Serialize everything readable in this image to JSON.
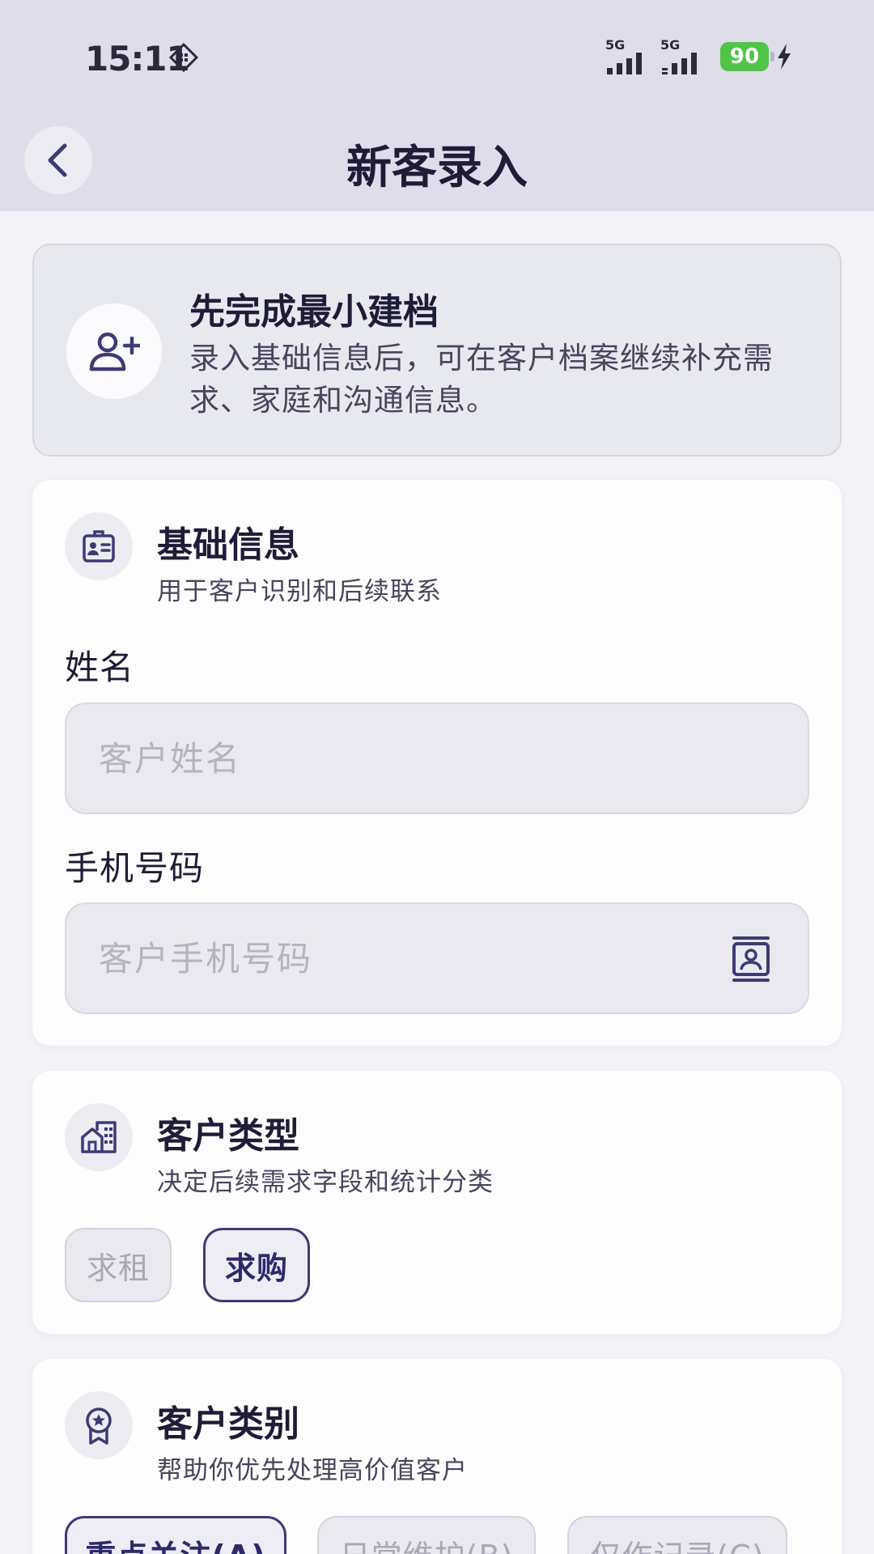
{
  "status_bar": {
    "time": "15:11",
    "sim1_label": "5G",
    "sim2_label": "5G",
    "battery": "90"
  },
  "header": {
    "title": "新客录入",
    "back_icon": "chevron-left-icon"
  },
  "intro": {
    "title": "先完成最小建档",
    "description": "录入基础信息后，可在客户档案继续补充需求、家庭和沟通信息。",
    "icon": "add-user-icon"
  },
  "basic_info": {
    "title": "基础信息",
    "subtitle": "用于客户识别和后续联系",
    "name_label": "姓名",
    "name_placeholder": "客户姓名",
    "name_value": "",
    "phone_label": "手机号码",
    "phone_placeholder": "客户手机号码",
    "phone_value": ""
  },
  "customer_type": {
    "title": "客户类型",
    "subtitle": "决定后续需求字段和统计分类",
    "options": [
      {
        "label": "求租",
        "selected": false
      },
      {
        "label": "求购",
        "selected": true
      }
    ]
  },
  "customer_category": {
    "title": "客户类别",
    "subtitle": "帮助你优先处理高价值客户",
    "options": [
      {
        "label": "重点关注(A)",
        "selected": true
      },
      {
        "label": "日常维护(B)",
        "selected": false
      },
      {
        "label": "仅作记录(C)",
        "selected": false
      }
    ]
  },
  "colors": {
    "accent": "#3d3b75",
    "header_bg": "#dedde9",
    "battery": "#4fc447"
  }
}
